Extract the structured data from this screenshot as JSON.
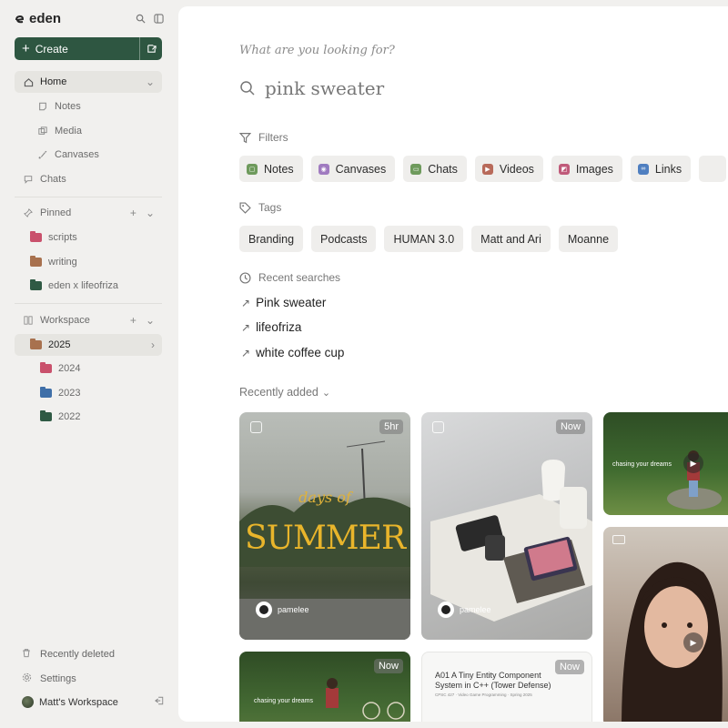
{
  "sidebar": {
    "brand": "eden",
    "create_label": "Create",
    "home": "Home",
    "notes": "Notes",
    "media": "Media",
    "canvases": "Canvases",
    "chats": "Chats",
    "pinned": "Pinned",
    "pinned_items": [
      {
        "label": "scripts",
        "color": "#c9516c"
      },
      {
        "label": "writing",
        "color": "#a8714e"
      },
      {
        "label": "eden x lifeofriza",
        "color": "#2f5a44"
      }
    ],
    "workspace": "Workspace",
    "workspace_items": [
      {
        "label": "2025",
        "color": "#a8714e"
      },
      {
        "label": "2024",
        "color": "#c9516c"
      },
      {
        "label": "2023",
        "color": "#3f6fa8"
      },
      {
        "label": "2022",
        "color": "#2f5a44"
      }
    ],
    "recently_deleted": "Recently deleted",
    "settings": "Settings",
    "workspace_name": "Matt's Workspace"
  },
  "search": {
    "prompt": "What are you looking for?",
    "query": "pink sweater"
  },
  "filters": {
    "label": "Filters",
    "items": [
      {
        "label": "Notes",
        "color": "#6e9a5c"
      },
      {
        "label": "Canvases",
        "color": "#a07bc0"
      },
      {
        "label": "Chats",
        "color": "#6e9a5c"
      },
      {
        "label": "Videos",
        "color": "#b86a5a"
      },
      {
        "label": "Images",
        "color": "#c05a7a"
      },
      {
        "label": "Links",
        "color": "#4f7fc0"
      }
    ]
  },
  "tags": {
    "label": "Tags",
    "items": [
      "Branding",
      "Podcasts",
      "HUMAN 3.0",
      "Matt and Ari",
      "Moanne"
    ]
  },
  "recent": {
    "label": "Recent searches",
    "items": [
      "Pink sweater",
      "lifeofriza",
      "white coffee cup"
    ]
  },
  "recently_added": {
    "label": "Recently added",
    "cards": [
      {
        "badge": "5hr",
        "title_small": "days of",
        "title_big": "SUMMER",
        "author": "pamelee"
      },
      {
        "badge": "Now",
        "author": "pamelee"
      },
      {
        "caption": "chasing your dreams"
      },
      {},
      {
        "badge": "Now",
        "caption": "chasing your dreams"
      },
      {
        "badge": "Now",
        "title": "A01 A Tiny Entity Component System in C++ (Tower Defense)",
        "subtitle": "CPSC 427 · Video Game Programming · Spring 2025"
      }
    ]
  },
  "colors": {
    "create_bg": "#2e5641",
    "sidebar_bg": "#f1f0ee",
    "chip_bg": "#efeeec"
  }
}
